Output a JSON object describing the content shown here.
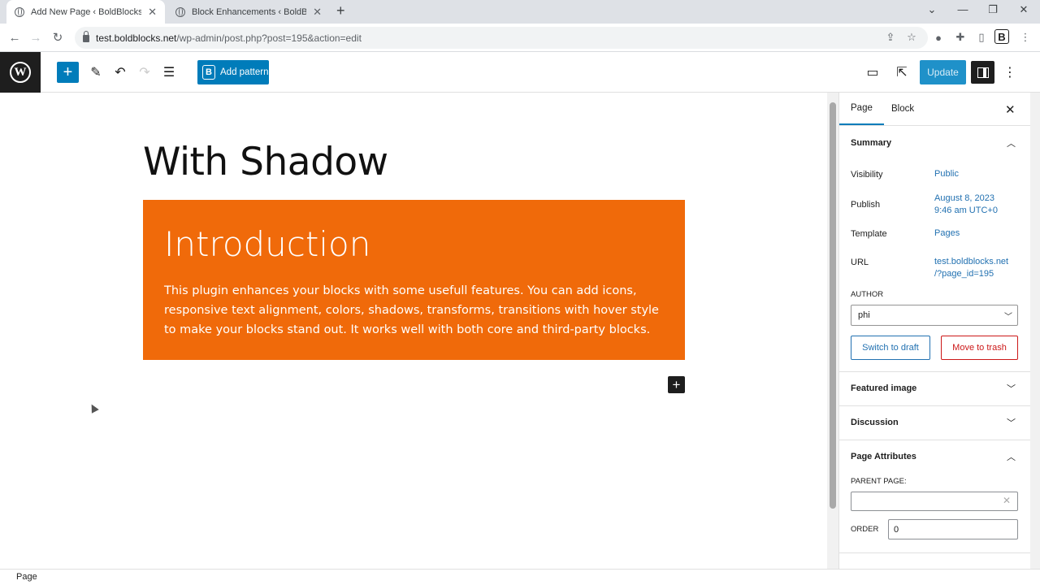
{
  "browser": {
    "tabs": [
      {
        "title": "Add New Page ‹ BoldBlocks — W",
        "active": true
      },
      {
        "title": "Block Enhancements ‹ BoldBlock",
        "active": false
      }
    ],
    "new_tab": "+",
    "window_controls": [
      "⌄",
      "—",
      "❐",
      "✕"
    ],
    "url_host": "test.boldblocks.net",
    "url_path": "/wp-admin/post.php?post=195&action=edit",
    "extension_letter": "B"
  },
  "wp_header": {
    "add_pattern_label": "Add pattern",
    "pattern_icon_letter": "B",
    "update_label": "Update"
  },
  "editor": {
    "page_title": "With Shadow",
    "block": {
      "heading": "Introduction",
      "text": "This plugin enhances your blocks with some usefull features. You can add icons, responsive text alignment, colors, shadows, transforms, transitions with hover style to make your blocks stand out. It works well with both core and third-party blocks.",
      "background": "#f06a0a"
    }
  },
  "sidebar": {
    "tabs": [
      "Page",
      "Block"
    ],
    "summary_title": "Summary",
    "rows": [
      {
        "label": "Visibility",
        "value": "Public"
      },
      {
        "label": "Publish",
        "value": "August 8, 2023",
        "value2": "9:46 am UTC+0"
      },
      {
        "label": "Template",
        "value": "Pages"
      },
      {
        "label": "URL",
        "value": "test.boldblocks.net",
        "value2": "/?page_id=195"
      }
    ],
    "author_label": "AUTHOR",
    "author_value": "phi",
    "switch_draft": "Switch to draft",
    "move_trash": "Move to trash",
    "featured_image": "Featured image",
    "discussion": "Discussion",
    "page_attributes": "Page Attributes",
    "parent_page_label": "PARENT PAGE:",
    "order_label": "ORDER",
    "order_value": "0"
  },
  "footer": {
    "breadcrumb": "Page"
  },
  "colors": {
    "accent": "#007cba",
    "link": "#2271b1",
    "danger": "#cc1818"
  }
}
